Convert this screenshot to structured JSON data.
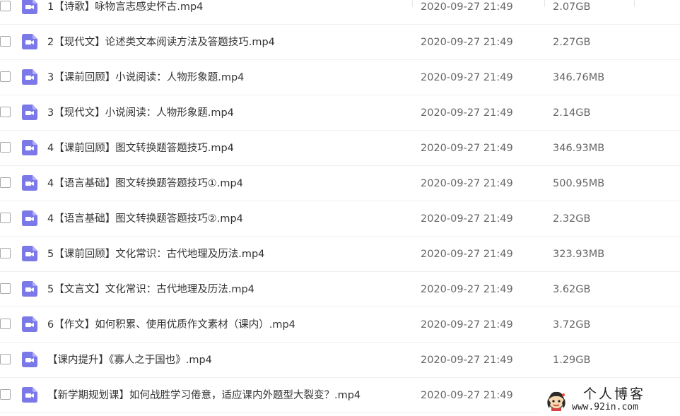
{
  "files": [
    {
      "name": "1【诗歌】咏物言志感史怀古.mp4",
      "date": "2020-09-27 21:49",
      "size": "2.07GB",
      "icon": "video-file-icon"
    },
    {
      "name": "2【现代文】论述类文本阅读方法及答题技巧.mp4",
      "date": "2020-09-27 21:49",
      "size": "2.27GB",
      "icon": "video-file-icon"
    },
    {
      "name": "3【课前回顾】小说阅读：人物形象题.mp4",
      "date": "2020-09-27 21:49",
      "size": "346.76MB",
      "icon": "video-file-icon"
    },
    {
      "name": "3【现代文】小说阅读：人物形象题.mp4",
      "date": "2020-09-27 21:49",
      "size": "2.14GB",
      "icon": "video-file-icon"
    },
    {
      "name": "4【课前回顾】图文转换题答题技巧.mp4",
      "date": "2020-09-27 21:49",
      "size": "346.93MB",
      "icon": "video-file-icon"
    },
    {
      "name": "4【语言基础】图文转换题答题技巧①.mp4",
      "date": "2020-09-27 21:49",
      "size": "500.95MB",
      "icon": "video-file-icon"
    },
    {
      "name": "4【语言基础】图文转换题答题技巧②.mp4",
      "date": "2020-09-27 21:49",
      "size": "2.32GB",
      "icon": "video-file-icon"
    },
    {
      "name": "5【课前回顾】文化常识：古代地理及历法.mp4",
      "date": "2020-09-27 21:49",
      "size": "323.93MB",
      "icon": "video-file-icon"
    },
    {
      "name": "5【文言文】文化常识：古代地理及历法.mp4",
      "date": "2020-09-27 21:49",
      "size": "3.62GB",
      "icon": "video-file-icon"
    },
    {
      "name": "6【作文】如何积累、使用优质作文素材（课内）.mp4",
      "date": "2020-09-27 21:49",
      "size": "3.72GB",
      "icon": "video-file-icon"
    },
    {
      "name": "【课内提升】《寡人之于国也》.mp4",
      "date": "2020-09-27 21:49",
      "size": "1.29GB",
      "icon": "video-file-icon"
    },
    {
      "name": "【新学期规划课】如何战胜学习倦意，适应课内外题型大裂变？.mp4",
      "date": "2020-09-27 21:49",
      "size": "",
      "icon": "video-file-icon"
    }
  ],
  "watermark": {
    "title": "个人博客",
    "url": "www.92in.com"
  },
  "colors": {
    "icon_accent": "#7b79e8",
    "divider": "#f0f0f0",
    "text_primary": "#333333",
    "text_secondary": "#666666"
  }
}
